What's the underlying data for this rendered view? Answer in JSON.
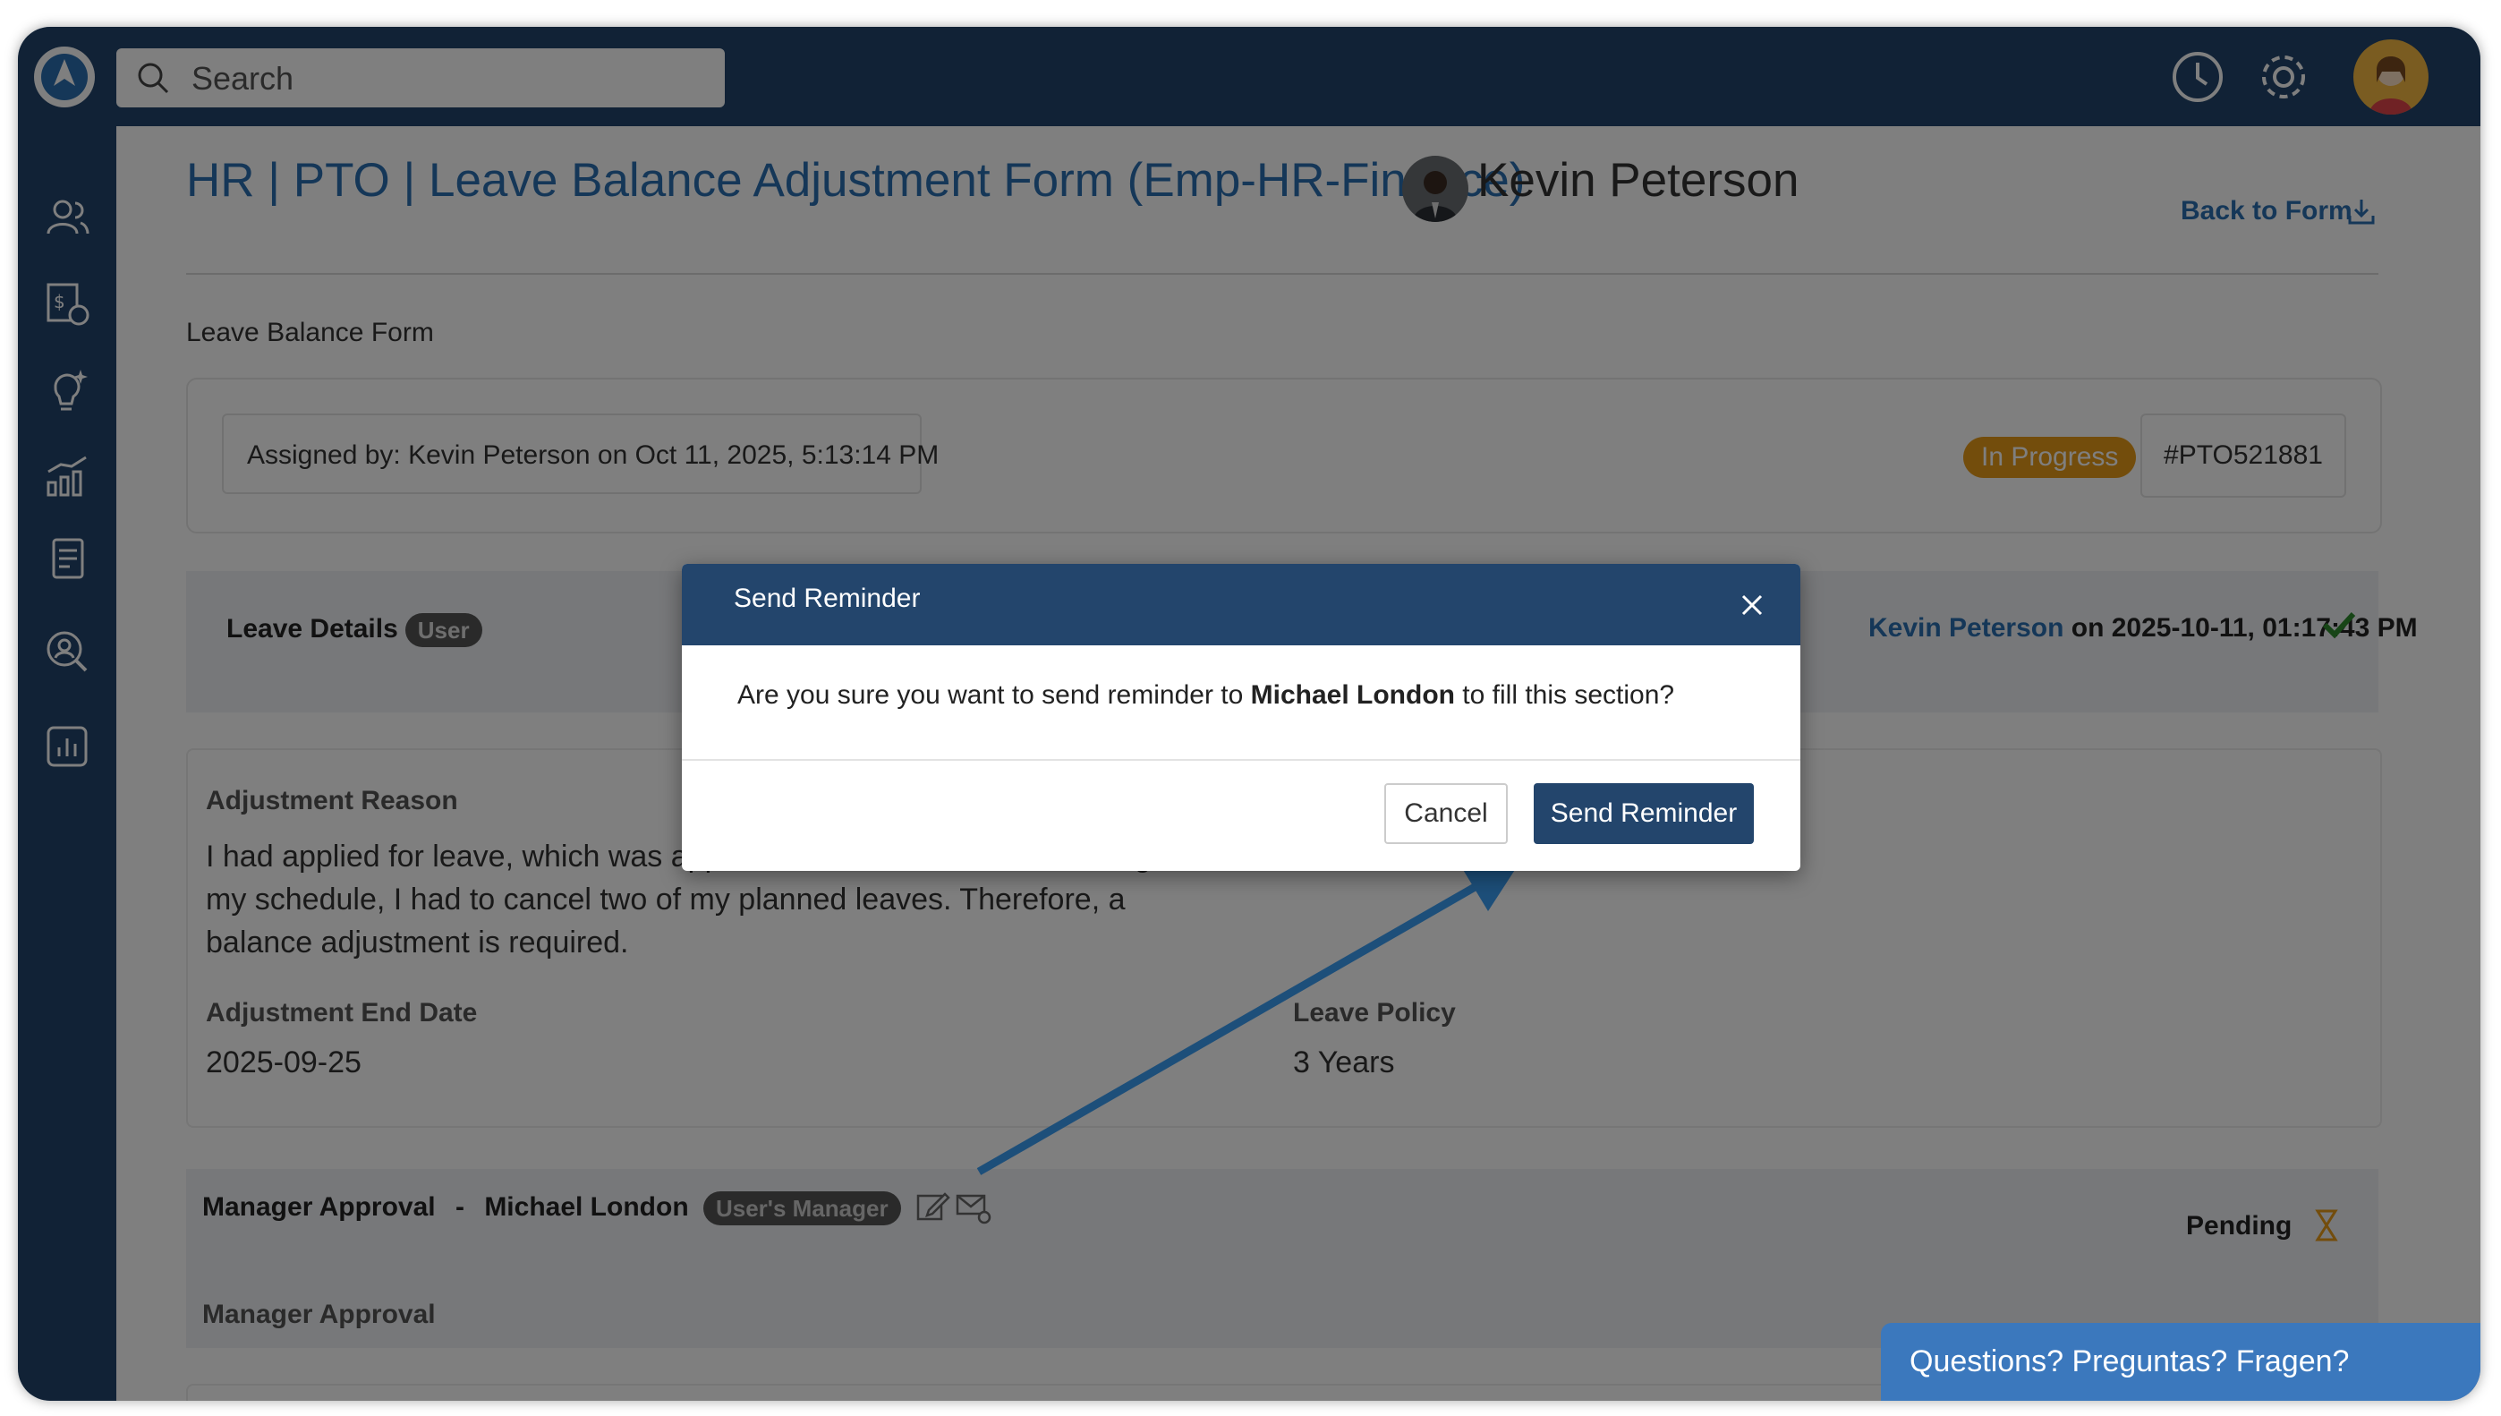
{
  "search": {
    "placeholder": "Search"
  },
  "header": {
    "icons": [
      "history-icon",
      "settings-icon",
      "user-avatar"
    ]
  },
  "sidebar": {
    "icons": [
      "users-icon",
      "payroll-icon",
      "ideas-icon",
      "analytics-icon",
      "documents-icon",
      "people-search-icon",
      "reports-icon"
    ]
  },
  "page": {
    "title": "HR | PTO | Leave Balance Adjustment Form (Emp-HR-Finance)",
    "person": "Kevin Peterson",
    "back_link": "Back to Form",
    "form_label": "Leave Balance Form"
  },
  "assignment": {
    "assigned_by": "Assigned by:  Kevin Peterson on Oct 11, 2025, 5:13:14 PM",
    "status": "In Progress",
    "ticket": "#PTO521881"
  },
  "leave_details": {
    "title": "Leave Details",
    "badge": "User",
    "completed_by_name": "Kevin Peterson",
    "completed_on": " on 2025-10-11, 01:17:43 PM"
  },
  "fields": {
    "reason_label": "Adjustment Reason",
    "reason_text": "I had applied for leave, which was approved. However, due to a change in my schedule, I had to cancel two of my planned leaves. Therefore, a balance adjustment is required.",
    "end_date_label": "Adjustment End Date",
    "end_date_value": "2025-09-25",
    "policy_label": "Leave Policy",
    "policy_value": "3 Years"
  },
  "manager": {
    "title": "Manager Approval",
    "separator": "-",
    "name": "Michael London",
    "badge": "User's Manager",
    "status": "Pending",
    "section_label": "Manager Approval"
  },
  "modal": {
    "title": "Send Reminder",
    "body_prefix": "Are you sure you want to send reminder to ",
    "body_name": "Michael London",
    "body_suffix": " to fill this section?",
    "cancel_label": "Cancel",
    "confirm_label": "Send Reminder"
  },
  "help": {
    "label": "Questions? Preguntas? Fragen?"
  },
  "colors": {
    "nav": "#23456c",
    "link": "#2a6fb0",
    "status_in_progress": "#e79a19",
    "help": "#3b78bd",
    "arrow": "#1d4f7a"
  }
}
